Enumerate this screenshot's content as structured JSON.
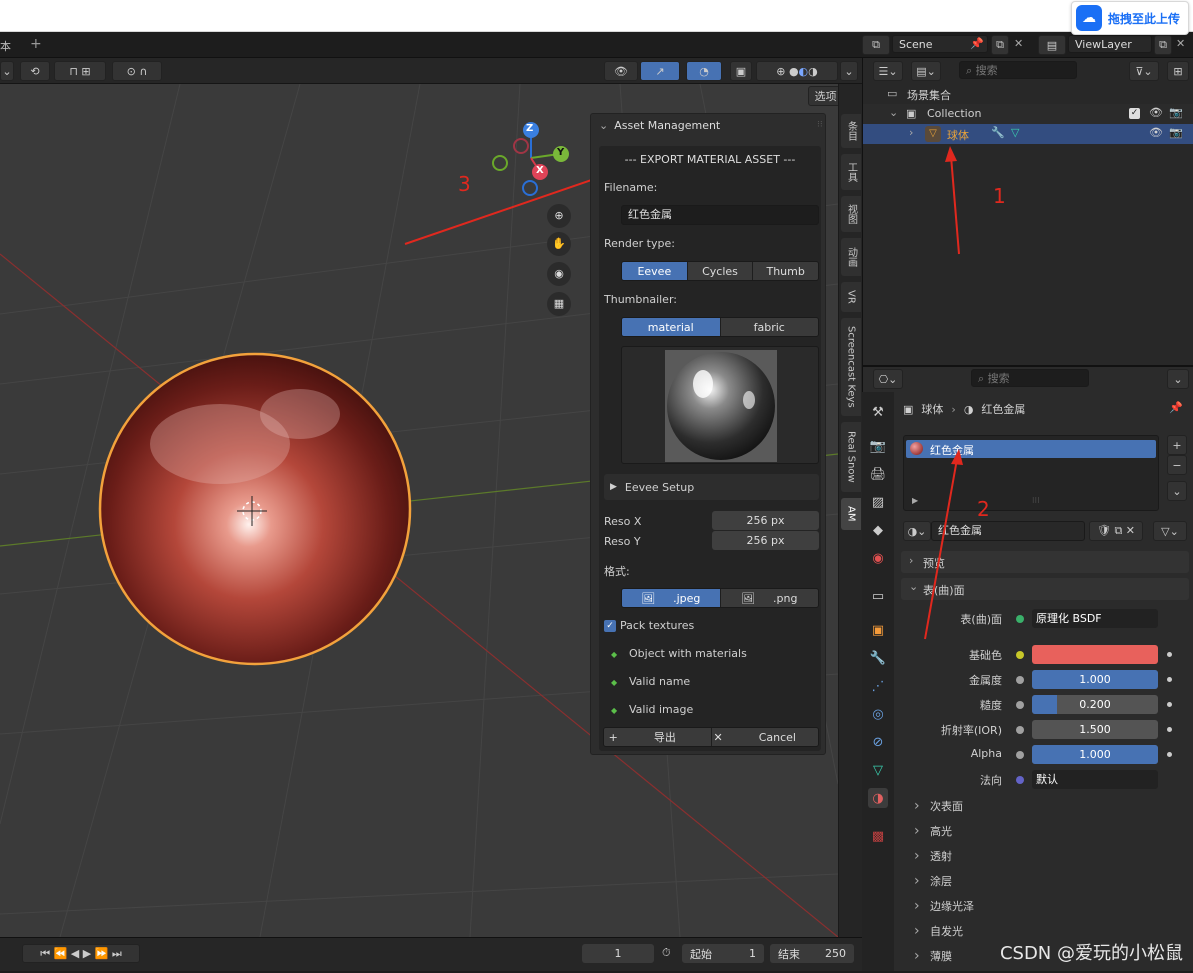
{
  "upload": {
    "label": "拖拽至此上传"
  },
  "workspace": {
    "tab_label": "脚本",
    "tab_partial": "本",
    "add_symbol": "+"
  },
  "scene": {
    "name": "Scene",
    "view_layer": "ViewLayer"
  },
  "viewport": {
    "options_label": "选项",
    "gizmo": {
      "x": "X",
      "y": "Y",
      "z": "Z"
    }
  },
  "sidebar_tabs": [
    "条目",
    "工具",
    "视图",
    "动画",
    "VR",
    "Screencast Keys",
    "Real Snow",
    "AM"
  ],
  "asset_panel": {
    "header": "Asset Management",
    "title": "--- EXPORT MATERIAL ASSET ---",
    "filename_label": "Filename:",
    "filename_value": "红色金属",
    "render_type_label": "Render type:",
    "render_types": [
      "Eevee",
      "Cycles",
      "Thumb"
    ],
    "render_type_selected": "Eevee",
    "thumbnailer_label": "Thumbnailer:",
    "thumbnailers": [
      "material",
      "fabric"
    ],
    "thumbnailer_selected": "material",
    "eevee_setup_label": "Eevee Setup",
    "reso_x_label": "Reso X",
    "reso_x_value": "256 px",
    "reso_y_label": "Reso Y",
    "reso_y_value": "256 px",
    "format_label": "格式:",
    "formats": [
      ".jpeg",
      ".png"
    ],
    "format_selected": ".jpeg",
    "pack_textures_label": "Pack textures",
    "pack_textures_checked": true,
    "checks": [
      "Object with materials",
      "Valid name",
      "Valid image"
    ],
    "export_label": "导出",
    "cancel_label": "Cancel"
  },
  "outliner": {
    "search_placeholder": "搜索",
    "scene_collection": "场景集合",
    "collection": "Collection",
    "object": "球体"
  },
  "properties": {
    "search_placeholder": "搜索",
    "breadcrumb_object": "球体",
    "breadcrumb_material": "红色金属",
    "slot_name": "红色金属",
    "material_name": "红色金属",
    "sections": {
      "preview": "预览",
      "surface": "表(曲)面"
    },
    "surface_label": "表(曲)面",
    "surface_shader": "原理化 BSDF",
    "base_color_label": "基础色",
    "base_color_hex": "#e8615c",
    "inputs": [
      {
        "label": "金属度",
        "value": "1.000",
        "fill": 1.0
      },
      {
        "label": "糙度",
        "value": "0.200",
        "fill": 0.2
      },
      {
        "label": "折射率(IOR)",
        "value": "1.500",
        "fill": 0.0
      },
      {
        "label": "Alpha",
        "value": "1.000",
        "fill": 1.0
      }
    ],
    "normal_label": "法向",
    "normal_value": "默认",
    "subpanels": [
      "次表面",
      "高光",
      "透射",
      "涂层",
      "边缘光泽",
      "自发光",
      "薄膜"
    ]
  },
  "timeline": {
    "current_frame": "1",
    "start_label": "起始",
    "start_value": "1",
    "end_label": "结束",
    "end_value": "250"
  },
  "annotations": {
    "one": "1",
    "two": "2",
    "three": "3"
  },
  "watermark": "CSDN @爱玩的小松鼠",
  "colors": {
    "accent": "#4772b3",
    "selection": "#334d80",
    "annotation": "#e0281e",
    "object_orange": "#e8a33a"
  }
}
